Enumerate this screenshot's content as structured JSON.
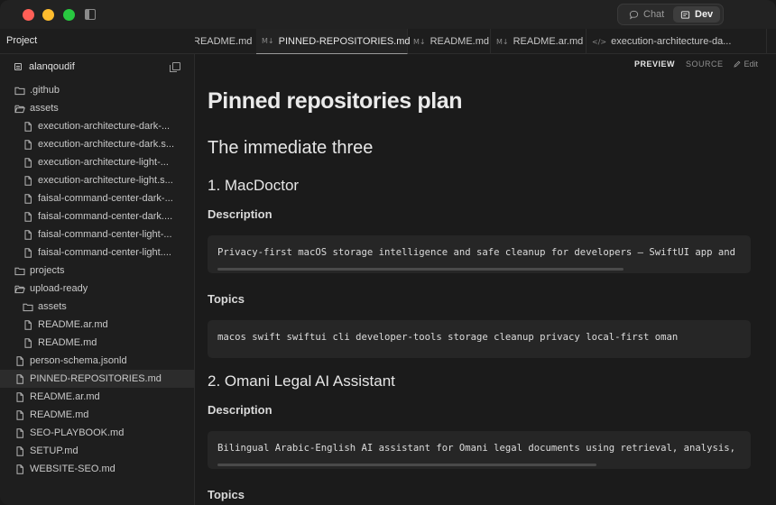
{
  "titlebar": {
    "modes": [
      {
        "label": "Chat",
        "icon": "chat-bubble-icon",
        "active": false
      },
      {
        "label": "Dev",
        "icon": "terminal-window-icon",
        "active": true
      }
    ]
  },
  "tabbar": {
    "project_label": "Project",
    "tabs": [
      {
        "label": "README.md",
        "icon": "",
        "active": false
      },
      {
        "label": "PINNED-REPOSITORIES.md",
        "icon": "M↓",
        "active": true
      },
      {
        "label": "README.md",
        "icon": "M↓",
        "active": false
      },
      {
        "label": "README.ar.md",
        "icon": "M↓",
        "active": false
      },
      {
        "label": "execution-architecture-da...",
        "icon": "</>",
        "active": false
      }
    ]
  },
  "sidebar": {
    "root_label": "alanqoudif",
    "items": [
      {
        "label": ".github",
        "type": "folder",
        "depth": 0
      },
      {
        "label": "assets",
        "type": "folder-open",
        "depth": 0
      },
      {
        "label": "execution-architecture-dark-...",
        "type": "file",
        "depth": 1
      },
      {
        "label": "execution-architecture-dark.s...",
        "type": "file",
        "depth": 1
      },
      {
        "label": "execution-architecture-light-...",
        "type": "file",
        "depth": 1
      },
      {
        "label": "execution-architecture-light.s...",
        "type": "file",
        "depth": 1
      },
      {
        "label": "faisal-command-center-dark-...",
        "type": "file",
        "depth": 1
      },
      {
        "label": "faisal-command-center-dark....",
        "type": "file",
        "depth": 1
      },
      {
        "label": "faisal-command-center-light-...",
        "type": "file",
        "depth": 1
      },
      {
        "label": "faisal-command-center-light....",
        "type": "file",
        "depth": 1
      },
      {
        "label": "projects",
        "type": "folder",
        "depth": 0
      },
      {
        "label": "upload-ready",
        "type": "folder-open",
        "depth": 0
      },
      {
        "label": "assets",
        "type": "folder",
        "depth": 1
      },
      {
        "label": "README.ar.md",
        "type": "file",
        "depth": 1
      },
      {
        "label": "README.md",
        "type": "file",
        "depth": 1
      },
      {
        "label": "person-schema.jsonld",
        "type": "file",
        "depth": 0
      },
      {
        "label": "PINNED-REPOSITORIES.md",
        "type": "file",
        "depth": 0,
        "selected": true
      },
      {
        "label": "README.ar.md",
        "type": "file",
        "depth": 0
      },
      {
        "label": "README.md",
        "type": "file",
        "depth": 0
      },
      {
        "label": "SEO-PLAYBOOK.md",
        "type": "file",
        "depth": 0
      },
      {
        "label": "SETUP.md",
        "type": "file",
        "depth": 0
      },
      {
        "label": "WEBSITE-SEO.md",
        "type": "file",
        "depth": 0
      }
    ]
  },
  "viewbar": {
    "preview": "PREVIEW",
    "source": "SOURCE",
    "edit": "Edit"
  },
  "doc": {
    "title": "Pinned repositories plan",
    "section": "The immediate three",
    "repo1": {
      "heading": "1. MacDoctor",
      "description_label": "Description",
      "description": "Privacy-first macOS storage intelligence and safe cleanup for developers — SwiftUI app and",
      "topics_label": "Topics",
      "topics": "macos swift swiftui cli developer-tools storage cleanup privacy local-first oman"
    },
    "repo2": {
      "heading": "2. Omani Legal AI Assistant",
      "description_label": "Description",
      "description": "Bilingual Arabic-English AI assistant for Omani legal documents using retrieval, analysis,",
      "topics_label": "Topics"
    }
  },
  "colors": {
    "traffic_red": "#ff5f57",
    "traffic_yellow": "#febc2e",
    "traffic_green": "#28c840",
    "background": "#1b1b1b",
    "code_background": "#262626"
  }
}
